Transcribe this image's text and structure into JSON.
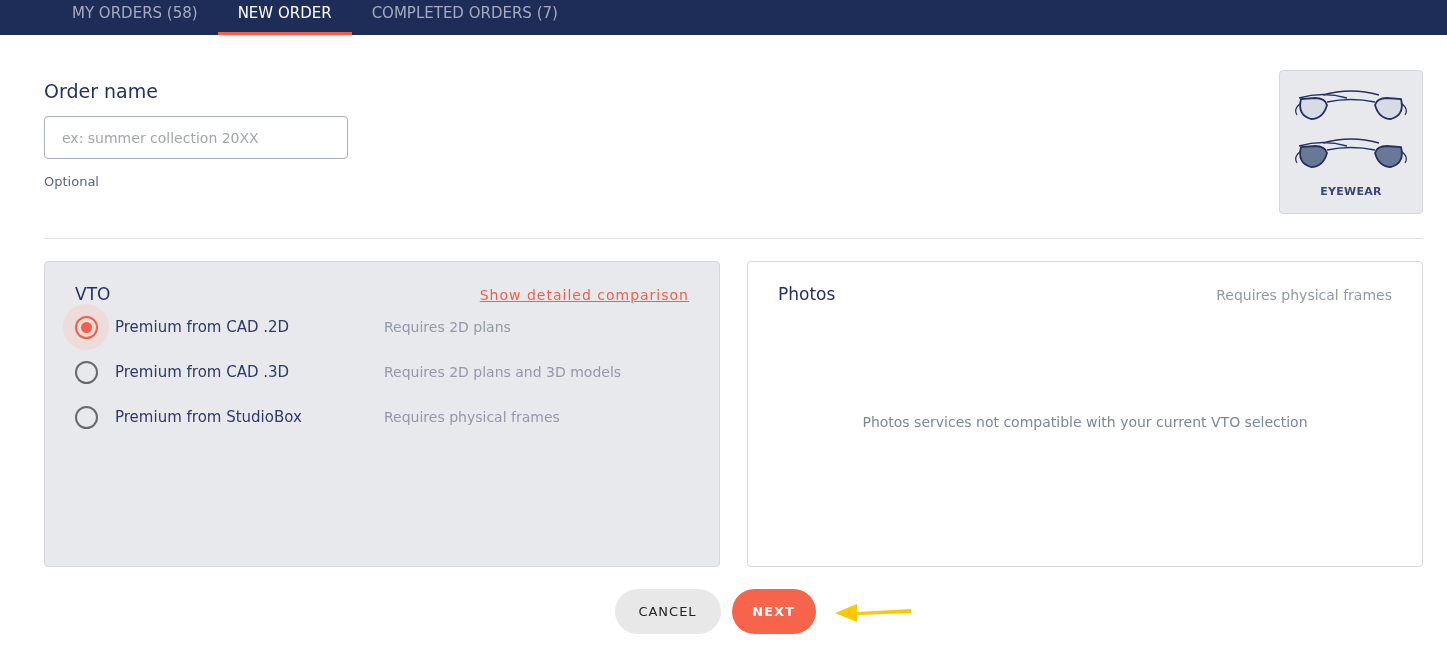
{
  "tabs": [
    {
      "label": "MY ORDERS (58)",
      "selected": false
    },
    {
      "label": "NEW ORDER",
      "selected": true
    },
    {
      "label": "COMPLETED ORDERS (7)",
      "selected": false
    }
  ],
  "order_name": {
    "label": "Order name",
    "placeholder": "ex: summer collection 20XX",
    "hint": "Optional"
  },
  "category": {
    "label": "EYEWEAR",
    "selected": true
  },
  "vto": {
    "title": "VTO",
    "link": "Show detailed comparison",
    "options": [
      {
        "label": "Premium from CAD .2D",
        "note": "Requires 2D plans",
        "selected": true
      },
      {
        "label": "Premium from CAD .3D",
        "note": "Requires 2D plans and 3D models",
        "selected": false
      },
      {
        "label": "Premium from StudioBox",
        "note": "Requires physical frames",
        "selected": false
      }
    ]
  },
  "photos": {
    "title": "Photos",
    "note": "Requires physical frames",
    "message": "Photos services not compatible with your current VTO selection"
  },
  "buttons": [
    {
      "kind": "secondary",
      "label": "CANCEL"
    },
    {
      "kind": "primary",
      "label": "NEXT"
    }
  ]
}
